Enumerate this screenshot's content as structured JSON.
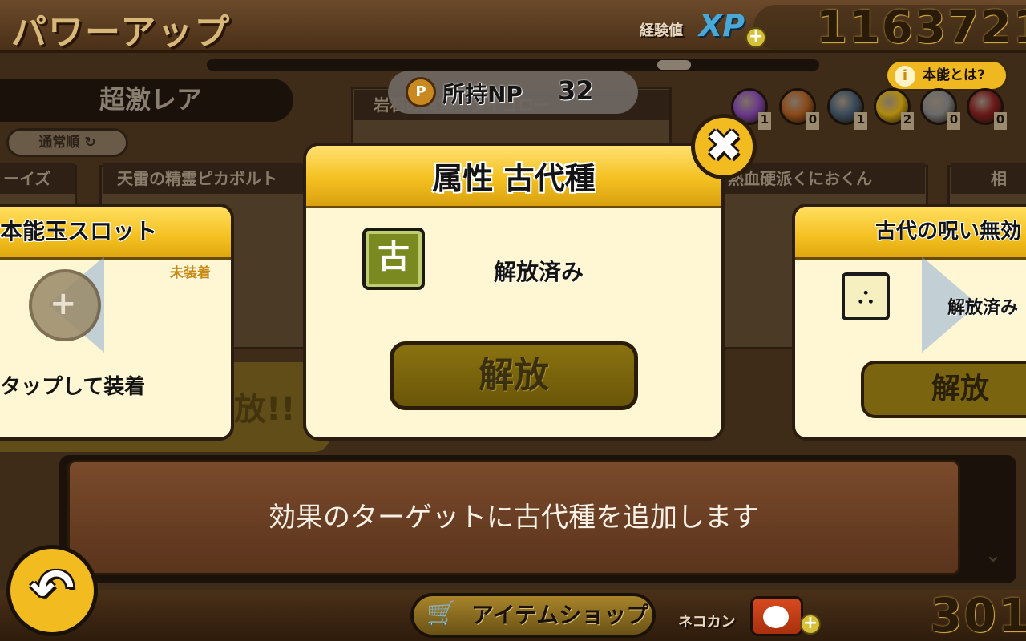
{
  "header": {
    "title": "パワーアップ",
    "xp_label": "経験値",
    "xp_badge": "XP",
    "xp_value": "1163721",
    "plus": "+"
  },
  "background": {
    "rarity_tab": "超激レア",
    "sort_label": "通常順",
    "np_label": "所持NP",
    "np_value": "32",
    "np_icon": "P",
    "info_button": "本能とは?",
    "info_icon": "i",
    "orbs": [
      {
        "color": "#6a3a8a",
        "count": "1"
      },
      {
        "color": "#8a4a1a",
        "count": "0"
      },
      {
        "color": "#3a4a5a",
        "count": "1"
      },
      {
        "color": "#b08a10",
        "count": "2"
      },
      {
        "color": "#6a6a6a",
        "count": "0"
      },
      {
        "color": "#6a1a1a",
        "count": "0"
      }
    ],
    "cards": [
      "ーイズ",
      "天雷の精霊ピカボルト",
      "岩石の精霊王ダイゴロー",
      "熱血硬派くにおくん",
      "相"
    ],
    "release_text": "放!!"
  },
  "left_panel": {
    "title": "本能玉スロット",
    "unequipped": "未装着",
    "hint": "タップして装着",
    "slot_plus": "+"
  },
  "dialog": {
    "title": "属性 古代種",
    "icon_char": "古",
    "status": "解放済み",
    "unlock_button": "解放",
    "close": "✖"
  },
  "right_panel": {
    "title": "古代の呪い無効",
    "status": "解放済み",
    "button": "解放",
    "icon": "⛬"
  },
  "description": {
    "text": "効果のターゲットに古代種を追加します",
    "scroll_icon": "⌄"
  },
  "footer": {
    "back_icon": "↶",
    "shop_label": "アイテムショップ",
    "cart_icon": "🛒",
    "can_label": "ネコカン",
    "can_value": "301",
    "plus": "+"
  }
}
